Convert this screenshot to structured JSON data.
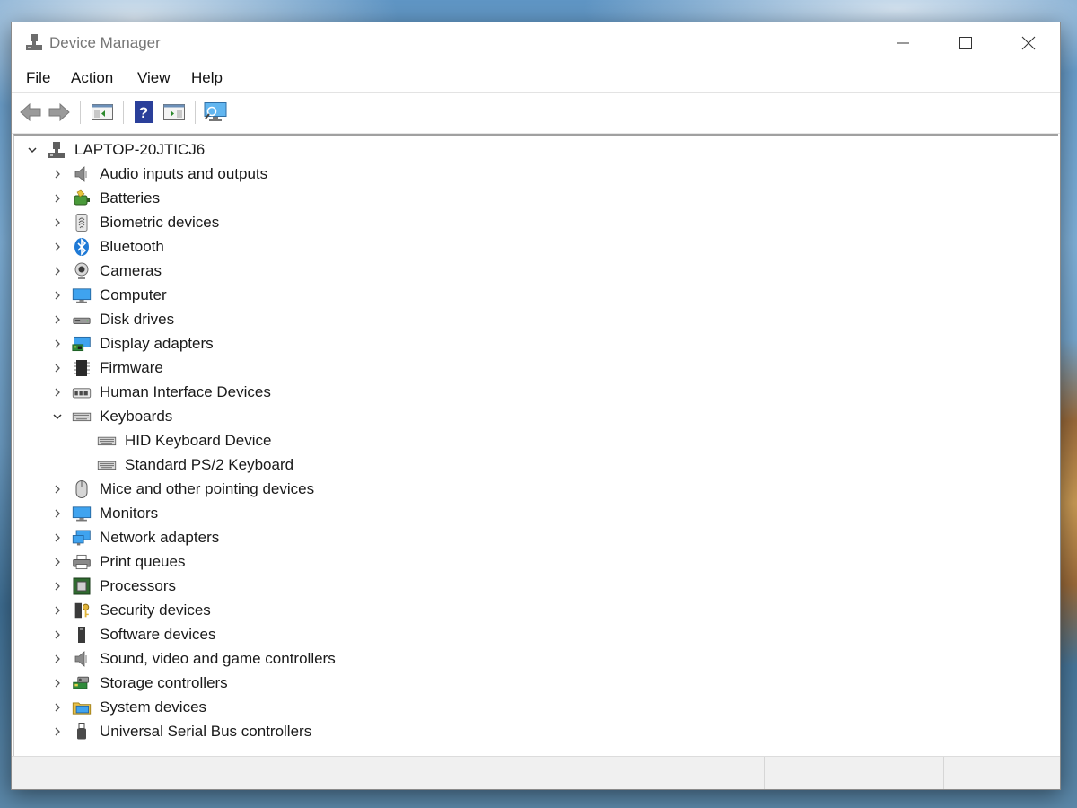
{
  "window": {
    "title": "Device Manager"
  },
  "menu": {
    "file": "File",
    "action": "Action",
    "view": "View",
    "help": "Help"
  },
  "toolbar": {
    "icons": [
      "back-arrow-icon",
      "forward-arrow-icon",
      "show-hide-console-tree-icon",
      "help-icon",
      "action-pane-icon",
      "scan-hardware-changes-icon"
    ]
  },
  "tree": {
    "root": {
      "label": "LAPTOP-20JTICJ6",
      "expanded": true,
      "icon": "computer-root-icon"
    },
    "categories": [
      {
        "label": "Audio inputs and outputs",
        "icon": "speaker-icon",
        "expanded": false
      },
      {
        "label": "Batteries",
        "icon": "battery-icon",
        "expanded": false
      },
      {
        "label": "Biometric devices",
        "icon": "fingerprint-icon",
        "expanded": false
      },
      {
        "label": "Bluetooth",
        "icon": "bluetooth-icon",
        "expanded": false
      },
      {
        "label": "Cameras",
        "icon": "webcam-icon",
        "expanded": false
      },
      {
        "label": "Computer",
        "icon": "monitor-icon",
        "expanded": false
      },
      {
        "label": "Disk drives",
        "icon": "disk-drive-icon",
        "expanded": false
      },
      {
        "label": "Display adapters",
        "icon": "display-adapter-icon",
        "expanded": false
      },
      {
        "label": "Firmware",
        "icon": "chip-icon",
        "expanded": false
      },
      {
        "label": "Human Interface Devices",
        "icon": "hid-icon",
        "expanded": false
      },
      {
        "label": "Keyboards",
        "icon": "keyboard-icon",
        "expanded": true,
        "children": [
          {
            "label": "HID Keyboard Device",
            "icon": "keyboard-icon"
          },
          {
            "label": "Standard PS/2 Keyboard",
            "icon": "keyboard-icon"
          }
        ]
      },
      {
        "label": "Mice and other pointing devices",
        "icon": "mouse-icon",
        "expanded": false
      },
      {
        "label": "Monitors",
        "icon": "monitor-icon",
        "expanded": false
      },
      {
        "label": "Network adapters",
        "icon": "network-adapter-icon",
        "expanded": false
      },
      {
        "label": "Print queues",
        "icon": "printer-icon",
        "expanded": false
      },
      {
        "label": "Processors",
        "icon": "processor-icon",
        "expanded": false
      },
      {
        "label": "Security devices",
        "icon": "security-key-icon",
        "expanded": false
      },
      {
        "label": "Software devices",
        "icon": "software-device-icon",
        "expanded": false
      },
      {
        "label": "Sound, video and game controllers",
        "icon": "speaker-icon",
        "expanded": false
      },
      {
        "label": "Storage controllers",
        "icon": "storage-controller-icon",
        "expanded": false
      },
      {
        "label": "System devices",
        "icon": "system-folder-icon",
        "expanded": false
      },
      {
        "label": "Universal Serial Bus controllers",
        "icon": "usb-icon",
        "expanded": false
      }
    ]
  },
  "colors": {
    "accent_blue": "#1e88e5",
    "tree_text": "#1a1a1a",
    "chrome_gray": "#f0f0f0"
  }
}
